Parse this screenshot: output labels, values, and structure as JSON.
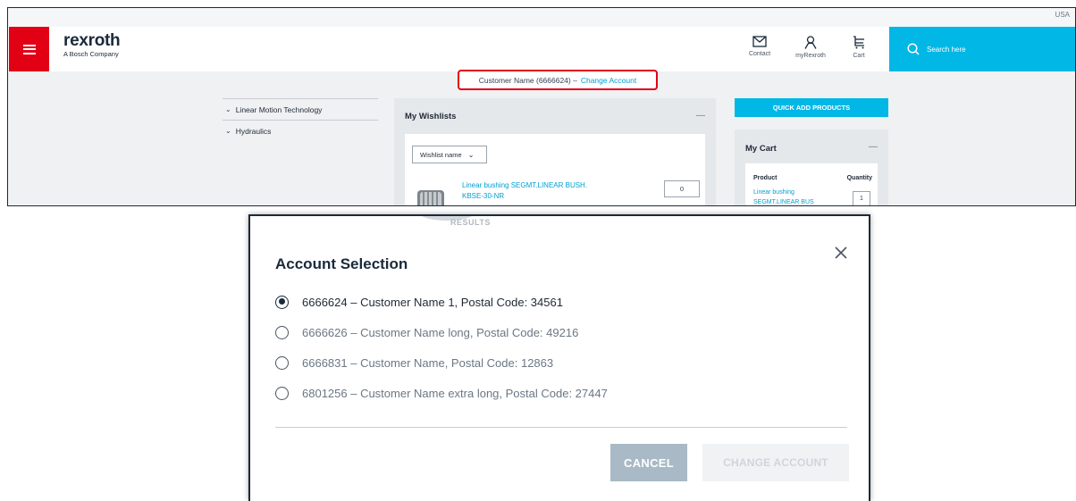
{
  "top": {
    "utility": {
      "country": "USA"
    },
    "logo": {
      "brand": "rexroth",
      "tagline": "A Bosch Company"
    },
    "header": {
      "contact_label": "Contact",
      "myrexroth_label": "myRexroth",
      "cart_label": "Cart",
      "search_placeholder": "Search here"
    },
    "account_bar": {
      "customer": "Customer Name (6666624) –",
      "change_link": "Change Account"
    },
    "nav": [
      {
        "label": "Linear Motion Technology"
      },
      {
        "label": "Hydraulics"
      }
    ],
    "wishlists": {
      "title": "My Wishlists",
      "collapse": "—",
      "select_label": "Wishlist name",
      "product_name": "Linear bushing SEGMT.LINEAR BUSH. KBSE-30-NR",
      "quantity": "0"
    },
    "quick_add_label": "QUICK ADD PRODUCTS",
    "cart": {
      "title": "My Cart",
      "collapse": "—",
      "col_product": "Product",
      "col_quantity": "Quantity",
      "product_name": "Linear bushing SEGMT.LINEAR BUS",
      "quantity": "1"
    }
  },
  "modal": {
    "title": "Account Selection",
    "backdrop_text": "RESULTS",
    "options": [
      {
        "label": "6666624 – Customer Name 1, Postal Code: 34561",
        "selected": true
      },
      {
        "label": "6666626 – Customer Name long, Postal Code: 49216",
        "selected": false
      },
      {
        "label": "6666831 – Customer Name, Postal Code: 12863",
        "selected": false
      },
      {
        "label": "6801256 – Customer Name extra long, Postal Code: 27447",
        "selected": false
      }
    ],
    "cancel_label": "CANCEL",
    "change_label": "CHANGE ACCOUNT"
  },
  "colors": {
    "brand_red": "#e20015",
    "accent_cyan": "#00b7e6",
    "link_blue": "#00a0d2",
    "navy": "#1a2a3a",
    "cancel_button": "#a9b9c5"
  }
}
